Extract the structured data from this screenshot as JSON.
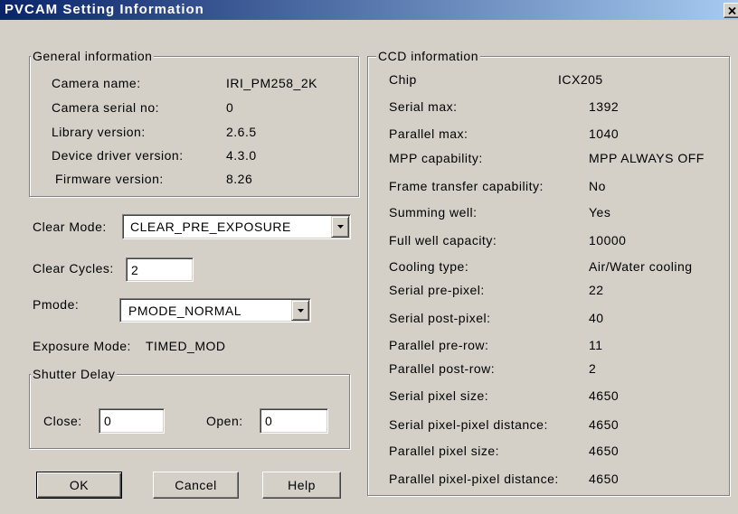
{
  "window": {
    "title": "PVCAM Setting Information",
    "close_icon": "close-icon",
    "colors": {
      "title_gradient_start": "#0A246A",
      "title_gradient_end": "#A6CAF0",
      "face": "#D4D0C8"
    }
  },
  "general": {
    "legend": "General information",
    "rows": [
      {
        "label": "Camera name:",
        "value": "IRI_PM258_2K"
      },
      {
        "label": "Camera serial no:",
        "value": "0"
      },
      {
        "label": "Library version:",
        "value": "2.6.5"
      },
      {
        "label": "Device driver version:",
        "value": "4.3.0"
      },
      {
        "label": "Firmware version:",
        "value": "8.26"
      }
    ]
  },
  "clear_mode": {
    "label": "Clear Mode:",
    "selected": "CLEAR_PRE_EXPOSURE",
    "arrow_icon": "chevron-down-icon"
  },
  "clear_cycles": {
    "label": "Clear Cycles:",
    "value": "2"
  },
  "pmode": {
    "label": "Pmode:",
    "selected": "PMODE_NORMAL",
    "arrow_icon": "chevron-down-icon"
  },
  "exposure_mode": {
    "label": "Exposure Mode:",
    "value": "TIMED_MOD"
  },
  "shutter_delay": {
    "legend": "Shutter Delay",
    "close_label": "Close:",
    "close_value": "0",
    "open_label": "Open:",
    "open_value": "0"
  },
  "buttons": {
    "ok": "OK",
    "cancel": "Cancel",
    "help": "Help"
  },
  "ccd": {
    "legend": "CCD information",
    "rows": [
      {
        "label": "Chip",
        "value": "ICX205"
      },
      {
        "label": "Serial max:",
        "value": "1392"
      },
      {
        "label": "Parallel max:",
        "value": "1040"
      },
      {
        "label": "MPP capability:",
        "value": "MPP ALWAYS OFF"
      },
      {
        "label": "Frame transfer capability:",
        "value": "No"
      },
      {
        "label": "Summing well:",
        "value": "Yes"
      },
      {
        "label": "Full well capacity:",
        "value": "10000"
      },
      {
        "label": "Cooling type:",
        "value": "Air/Water cooling"
      },
      {
        "label": "Serial pre-pixel:",
        "value": "22"
      },
      {
        "label": "Serial post-pixel:",
        "value": "40"
      },
      {
        "label": "Parallel pre-row:",
        "value": "11"
      },
      {
        "label": "Parallel post-row:",
        "value": "2"
      },
      {
        "label": "Serial pixel size:",
        "value": "4650"
      },
      {
        "label": "Serial pixel-pixel distance:",
        "value": "4650"
      },
      {
        "label": "Parallel pixel size:",
        "value": "4650"
      },
      {
        "label": "Parallel pixel-pixel distance:",
        "value": "4650"
      }
    ]
  }
}
